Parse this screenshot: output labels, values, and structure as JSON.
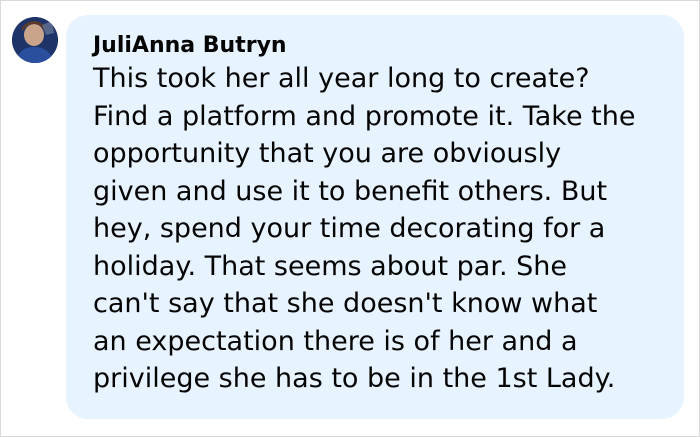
{
  "comment": {
    "author": "JuliAnna Butryn",
    "avatar_icon": "user-photo-avatar",
    "lines": [
      "This took her all year long to create?",
      "Find a platform and promote it. Take the",
      "opportunity that you are obviously",
      "given and use it to benefit others. But",
      "hey, spend your time decorating for a",
      "holiday. That seems about par. She",
      "can't say that she doesn't know what",
      "an expectation there is of her and a",
      "privilege she has to be in the 1st Lady."
    ]
  },
  "colors": {
    "bubble_background": "#e7f3ff",
    "text": "#050505"
  }
}
